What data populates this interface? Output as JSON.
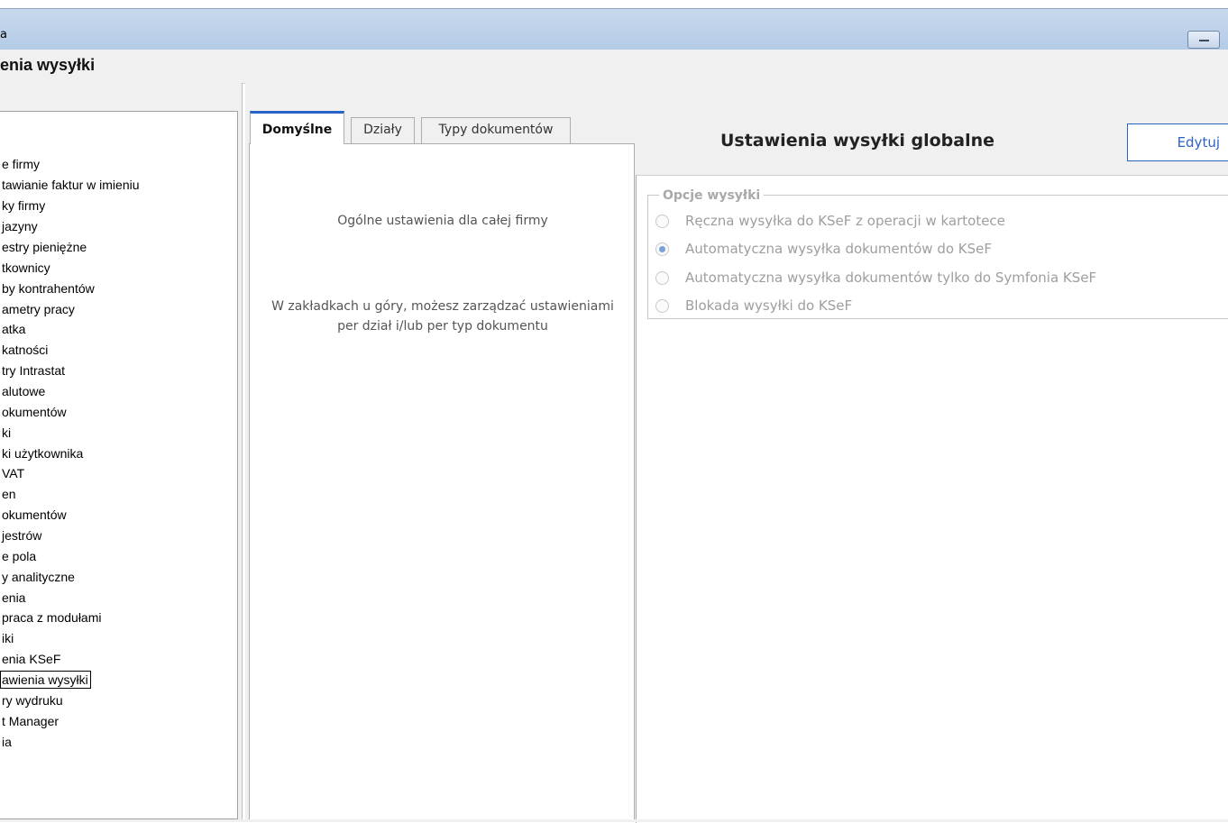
{
  "window": {
    "title_fragment": "a",
    "page_title": "enia wysyłki"
  },
  "sidebar": {
    "items": [
      {
        "label": "e firmy"
      },
      {
        "label": "tawianie faktur w imieniu"
      },
      {
        "label": "ky firmy"
      },
      {
        "label": "jazyny"
      },
      {
        "label": "estry pieniężne"
      },
      {
        "label": "tkownicy"
      },
      {
        "label": "by kontrahentów"
      },
      {
        "label": "ametry pracy"
      },
      {
        "label": "atka"
      },
      {
        "label": "katności"
      },
      {
        "label": "try Intrastat"
      },
      {
        "label": "alutowe"
      },
      {
        "label": "okumentów"
      },
      {
        "label": "ki"
      },
      {
        "label": "ki użytkownika"
      },
      {
        "label": "VAT"
      },
      {
        "label": "en"
      },
      {
        "label": "okumentów"
      },
      {
        "label": "jestrów"
      },
      {
        "label": "e pola"
      },
      {
        "label": "y analityczne"
      },
      {
        "label": "enia"
      },
      {
        "label": "praca z modułami"
      },
      {
        "label": "iki"
      },
      {
        "label": "enia KSeF"
      },
      {
        "label": "awienia wysyłki",
        "selected": true
      },
      {
        "label": "ry wydruku"
      },
      {
        "label": "t Manager"
      },
      {
        "label": "ia"
      }
    ]
  },
  "tabs": [
    {
      "label": "Domyślne",
      "active": true
    },
    {
      "label": "Działy"
    },
    {
      "label": "Typy dokumentów"
    }
  ],
  "tab_content": {
    "line1": "Ogólne ustawienia dla całej firmy",
    "line2": "W zakładkach u góry, możesz zarządzać ustawieniami",
    "line3": "per dział i/lub per typ dokumentu"
  },
  "settings": {
    "title": "Ustawienia wysyłki globalne",
    "edit_label": "Edytuj",
    "group_label": "Opcje wysyłki",
    "options": [
      {
        "label": "Ręczna wysyłka do KSeF z operacji w kartotece",
        "checked": false
      },
      {
        "label": "Automatyczna wysyłka dokumentów do KSeF",
        "checked": true
      },
      {
        "label": "Automatyczna wysyłka dokumentów tylko do Symfonia KSeF",
        "checked": false
      },
      {
        "label": "Blokada wysyłki do KSeF",
        "checked": false
      }
    ]
  },
  "colors": {
    "accent": "#2a63c7",
    "radio_selected": "#7a9fd9",
    "disabled_text": "#9e9e9e"
  }
}
